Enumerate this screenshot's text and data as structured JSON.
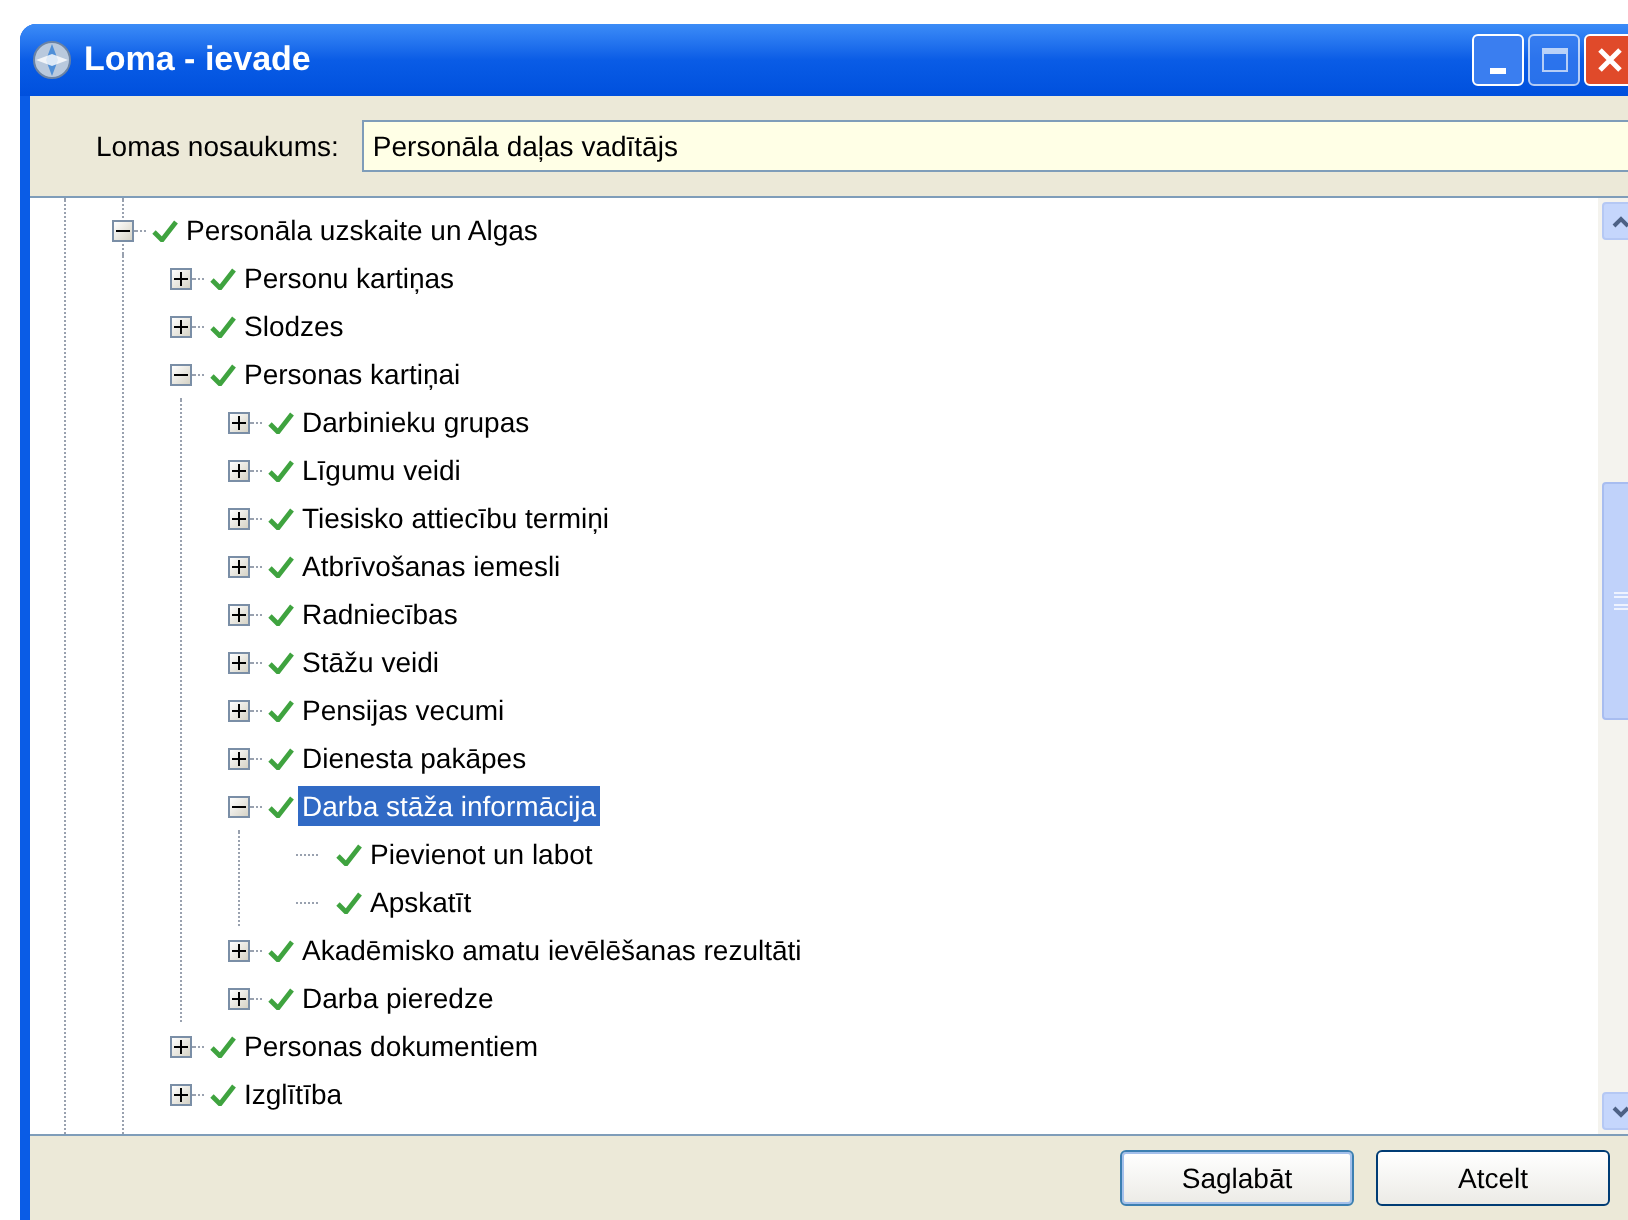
{
  "window": {
    "title": "Loma - ievade"
  },
  "name_field": {
    "label": "Lomas nosaukums:",
    "value": "Personāla daļas vadītājs"
  },
  "tree": [
    {
      "label": "Personāla uzskaite un Algas",
      "checked": true,
      "expanded": true,
      "selected": false,
      "children": [
        {
          "label": "Personu kartiņas",
          "checked": true,
          "expanded": false,
          "selected": false
        },
        {
          "label": "Slodzes",
          "checked": true,
          "expanded": false,
          "selected": false
        },
        {
          "label": "Personas kartiņai",
          "checked": true,
          "expanded": true,
          "selected": false,
          "children": [
            {
              "label": "Darbinieku grupas",
              "checked": true,
              "expanded": false,
              "selected": false
            },
            {
              "label": "Līgumu veidi",
              "checked": true,
              "expanded": false,
              "selected": false
            },
            {
              "label": "Tiesisko attiecību termiņi",
              "checked": true,
              "expanded": false,
              "selected": false
            },
            {
              "label": "Atbrīvošanas iemesli",
              "checked": true,
              "expanded": false,
              "selected": false
            },
            {
              "label": "Radniecības",
              "checked": true,
              "expanded": false,
              "selected": false
            },
            {
              "label": "Stāžu veidi",
              "checked": true,
              "expanded": false,
              "selected": false
            },
            {
              "label": "Pensijas vecumi",
              "checked": true,
              "expanded": false,
              "selected": false
            },
            {
              "label": "Dienesta pakāpes",
              "checked": true,
              "expanded": false,
              "selected": false
            },
            {
              "label": "Darba stāža informācija",
              "checked": true,
              "expanded": true,
              "selected": true,
              "children": [
                {
                  "label": "Pievienot un labot",
                  "checked": true,
                  "selected": false
                },
                {
                  "label": "Apskatīt",
                  "checked": true,
                  "selected": false
                }
              ]
            },
            {
              "label": "Akadēmisko amatu ievēlēšanas rezultāti",
              "checked": true,
              "expanded": false,
              "selected": false
            },
            {
              "label": "Darba pieredze",
              "checked": true,
              "expanded": false,
              "selected": false
            }
          ]
        },
        {
          "label": "Personas dokumentiem",
          "checked": true,
          "expanded": false,
          "selected": false
        },
        {
          "label": "Izglītība",
          "checked": true,
          "expanded": false,
          "selected": false
        }
      ]
    }
  ],
  "buttons": [
    "Saglabāt",
    "Atcelt"
  ]
}
